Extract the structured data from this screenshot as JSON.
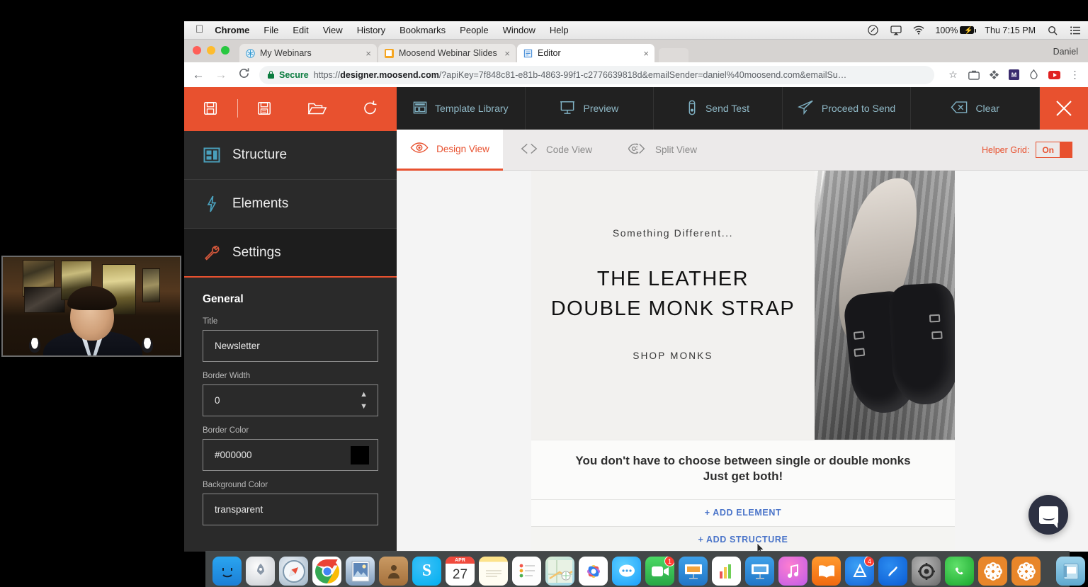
{
  "menubar": {
    "apple_icon": "apple-icon",
    "items": [
      "Chrome",
      "File",
      "Edit",
      "View",
      "History",
      "Bookmarks",
      "People",
      "Window",
      "Help"
    ],
    "status": {
      "shazam_icon": "shazam-icon",
      "airplay_icon": "airplay-icon",
      "wifi_icon": "wifi-icon",
      "battery_percent": "100%",
      "battery_icon": "battery-charging-icon",
      "clock": "Thu 7:15 PM",
      "search_icon": "spotlight-search-icon",
      "notifications_icon": "notification-center-icon"
    }
  },
  "browser": {
    "profile_name": "Daniel",
    "tabs": [
      {
        "title": "My Webinars",
        "icon": "snowflake-favicon",
        "close": "×",
        "active": false
      },
      {
        "title": "Moosend Webinar Slides - Goo",
        "icon": "slides-favicon",
        "close": "×",
        "active": false
      },
      {
        "title": "Editor",
        "icon": "editor-favicon",
        "close": "×",
        "active": true
      }
    ],
    "nav": {
      "back": "←",
      "forward": "→",
      "reload": "C"
    },
    "omnibox": {
      "security_label": "Secure",
      "url_prefix": "https://",
      "url_domain": "designer.moosend.com",
      "url_rest": "/?apiKey=7f848c81-e81b-4863-99f1-c2776639818d&emailSender=daniel%40moosend.com&emailSu…",
      "full_url": "https://designer.moosend.com/?apiKey=7f848c81-e81b-4863-99f1-c2776639818d&emailSender=daniel%40moosend.com&emailSu…"
    },
    "omnibox_icons": [
      "star-bookmark-icon",
      "screenshot-camera-icon",
      "extension-icon",
      "extension-purple-icon",
      "extension-flame-icon",
      "youtube-extension-icon",
      "chrome-menu-icon"
    ]
  },
  "editor": {
    "toolbar": {
      "accent_color": "#e8512f",
      "dark_color": "#212121",
      "left_actions": [
        {
          "name": "save-icon",
          "label": "Save"
        },
        {
          "name": "save-as-icon",
          "label": "Save As"
        },
        {
          "name": "open-folder-icon",
          "label": "Open"
        },
        {
          "name": "undo-icon",
          "label": "Undo"
        }
      ],
      "right_actions": [
        {
          "name": "template-library-icon",
          "label": "Template Library"
        },
        {
          "name": "preview-icon",
          "label": "Preview"
        },
        {
          "name": "send-test-icon",
          "label": "Send Test"
        },
        {
          "name": "proceed-to-send-icon",
          "label": "Proceed to Send"
        },
        {
          "name": "clear-icon",
          "label": "Clear"
        }
      ],
      "close_label": "✕"
    },
    "sidebar": {
      "items": [
        {
          "label": "Structure",
          "icon": "structure-icon",
          "active": false
        },
        {
          "label": "Elements",
          "icon": "elements-bolt-icon",
          "active": false
        },
        {
          "label": "Settings",
          "icon": "settings-wrench-icon",
          "active": true
        }
      ],
      "panel": {
        "section_title": "General",
        "fields": [
          {
            "label": "Title",
            "value": "Newsletter",
            "type": "text"
          },
          {
            "label": "Border Width",
            "value": "0",
            "type": "number"
          },
          {
            "label": "Border Color",
            "value": "#000000",
            "type": "color",
            "swatch": "#000000"
          },
          {
            "label": "Background Color",
            "value": "transparent",
            "type": "color"
          }
        ]
      }
    },
    "view_tabs": [
      {
        "label": "Design View",
        "icon": "eye-icon",
        "active": true
      },
      {
        "label": "Code View",
        "icon": "code-brackets-icon",
        "active": false
      },
      {
        "label": "Split View",
        "icon": "split-view-icon",
        "active": false
      }
    ],
    "helper_grid": {
      "label": "Helper Grid:",
      "state": "On"
    },
    "canvas_tools": [
      {
        "name": "device-preview-icon"
      },
      {
        "name": "settings-sliders-icon"
      }
    ],
    "email": {
      "hero_eyebrow": "Something Different...",
      "hero_title_line1": "THE LEATHER",
      "hero_title_line2": "DOUBLE MONK STRAP",
      "hero_cta": "SHOP MONKS",
      "hero_image_alt": "man-holding-double-monk-strap-shoes",
      "body_line1": "You don't have to choose between single or double monks",
      "body_line2": "Just get both!",
      "add_element_label": "+ ADD ELEMENT",
      "add_structure_label": "+ ADD STRUCTURE"
    },
    "chat_widget": {
      "name": "intercom-chat-button"
    }
  },
  "dock": {
    "items": [
      {
        "name": "finder",
        "running": true
      },
      {
        "name": "launchpad",
        "running": false
      },
      {
        "name": "safari",
        "running": false
      },
      {
        "name": "chrome",
        "running": true
      },
      {
        "name": "photo-booth",
        "running": false
      },
      {
        "name": "contacts",
        "running": false
      },
      {
        "name": "skype",
        "running": false
      },
      {
        "name": "calendar",
        "running": false,
        "day": "27",
        "month": "APR"
      },
      {
        "name": "notes",
        "running": false
      },
      {
        "name": "reminders",
        "running": false
      },
      {
        "name": "maps",
        "running": false
      },
      {
        "name": "photos",
        "running": false
      },
      {
        "name": "messages",
        "running": false
      },
      {
        "name": "facetime",
        "running": false,
        "badge": "1"
      },
      {
        "name": "keynote-alt",
        "running": false
      },
      {
        "name": "numbers",
        "running": false
      },
      {
        "name": "keynote",
        "running": true
      },
      {
        "name": "itunes",
        "running": false
      },
      {
        "name": "ibooks",
        "running": false
      },
      {
        "name": "app-store",
        "running": false,
        "badge": "4"
      },
      {
        "name": "shazam",
        "running": false
      },
      {
        "name": "system-preferences",
        "running": true
      },
      {
        "name": "whatsapp",
        "running": false
      },
      {
        "name": "flower-app-1",
        "running": true
      },
      {
        "name": "flower-app-2",
        "running": true
      },
      {
        "name": "documents-folder",
        "running": false
      },
      {
        "name": "downloads-stack",
        "running": false
      },
      {
        "name": "window-stack",
        "running": false
      },
      {
        "name": "trash",
        "running": false
      }
    ]
  },
  "webcam": {
    "name": "presenter-webcam-feed"
  }
}
